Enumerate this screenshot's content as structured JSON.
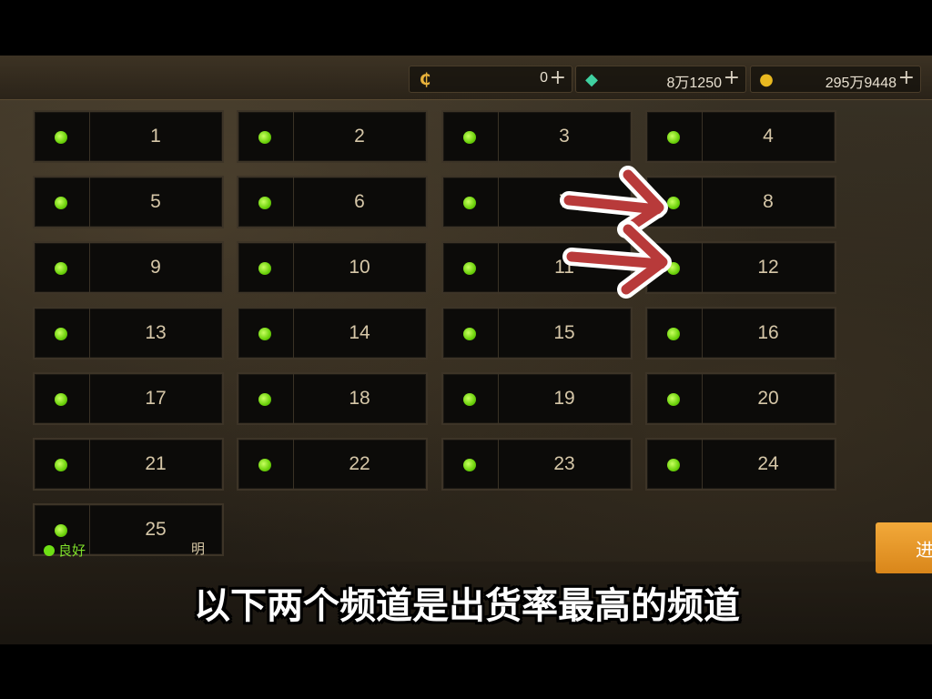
{
  "currencies": [
    {
      "icon": "coin-c-icon",
      "symbol": "₵",
      "color": "#e9b23a",
      "value": "0"
    },
    {
      "icon": "green-crystal-icon",
      "symbol": "◆",
      "color": "#3fd0a0",
      "value": "8万1250"
    },
    {
      "icon": "gold-coin-icon",
      "symbol": "●",
      "color": "#e8b820",
      "value": "295万9448"
    }
  ],
  "plus_symbol": "+",
  "channels": [
    "1",
    "2",
    "3",
    "4",
    "5",
    "6",
    "7",
    "8",
    "9",
    "10",
    "11",
    "12",
    "13",
    "14",
    "15",
    "16",
    "17",
    "18",
    "19",
    "20",
    "21",
    "22",
    "23",
    "24",
    "25"
  ],
  "status_color": "#6ee015",
  "legend": {
    "label": "良好"
  },
  "hidden_text": "明",
  "enter_button": {
    "label": "进"
  },
  "subtitle": "以下两个频道是出货率最高的频道",
  "arrow_color": "#b83a3a"
}
